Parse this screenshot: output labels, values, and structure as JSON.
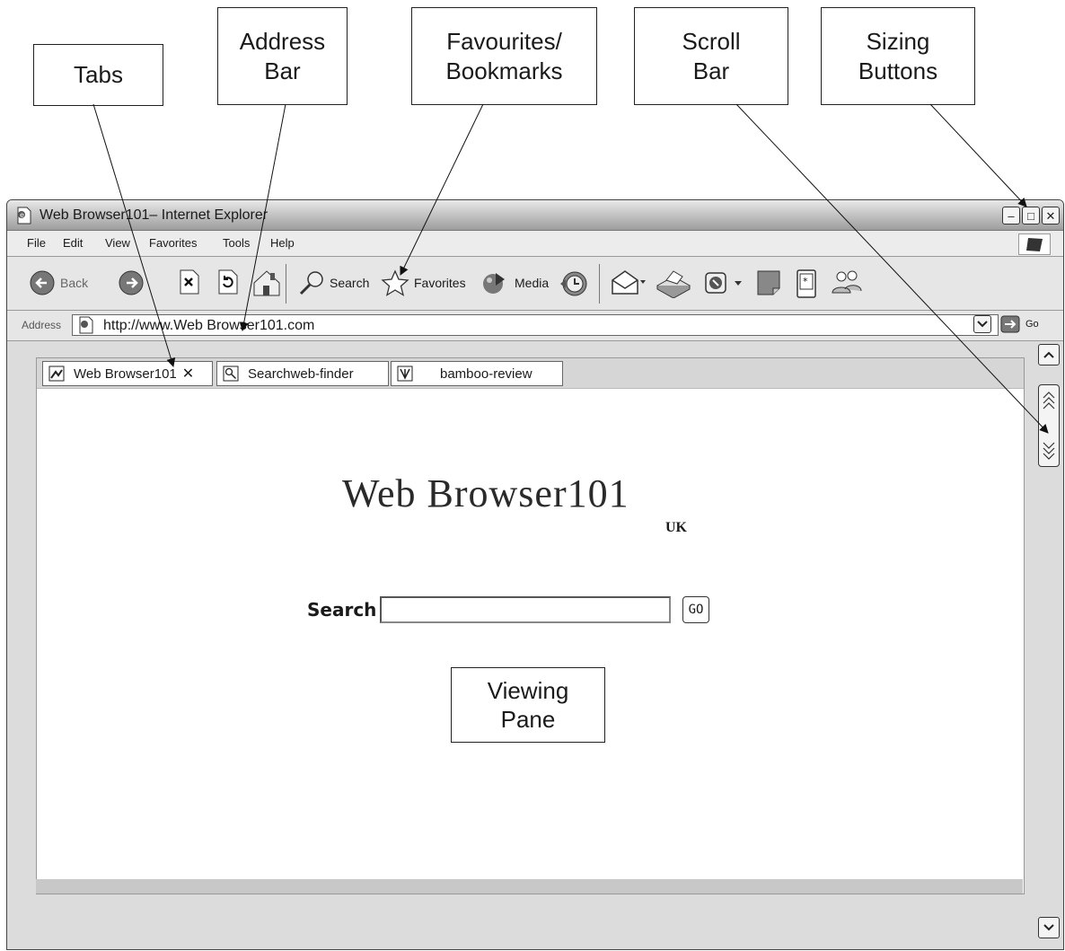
{
  "callouts": {
    "tabs": "Tabs",
    "address_bar": "Address\nBar",
    "favourites": "Favourites/\nBookmarks",
    "scroll_bar": "Scroll\nBar",
    "sizing_buttons": "Sizing\nButtons",
    "viewing_pane": "Viewing\nPane"
  },
  "window": {
    "title": "Web Browser101– Internet Explorer",
    "sizing": {
      "minimize": "–",
      "maximize": "□",
      "close": "✕"
    }
  },
  "menu": [
    "File",
    "Edit",
    "View",
    "Favorites",
    "Tools",
    "Help"
  ],
  "toolbar": {
    "back": "Back",
    "search": "Search",
    "favorites": "Favorites",
    "media": "Media"
  },
  "address": {
    "label": "Address",
    "url": "http://www.Web Browser101.com",
    "go": "Go"
  },
  "tabs": [
    {
      "label": "Web Browser101",
      "icon": "image-icon",
      "close": "✕"
    },
    {
      "label": "Searchweb-finder",
      "icon": "search-icon"
    },
    {
      "label": "bamboo-review",
      "icon": "bamboo-icon"
    }
  ],
  "page": {
    "logo": "Web Browser101",
    "logo_sub": "UK",
    "search_label": "Search",
    "search_value": "",
    "go": "GO"
  }
}
